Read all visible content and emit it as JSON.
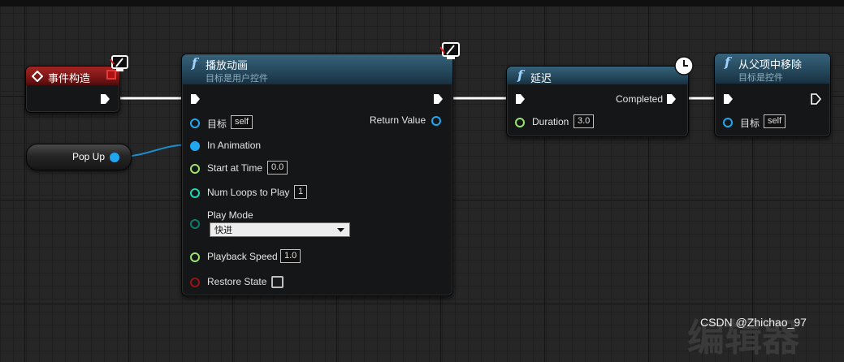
{
  "colors": {
    "exec": "#ffffff",
    "object_pin": "#1fa7f2",
    "float_pin": "#9be36a",
    "int_pin": "#1dd6b4",
    "enum_pin": "#0b7a6d",
    "bool_pin": "#9a1212",
    "wire_data": "#1a8fd0"
  },
  "event_node": {
    "title": "事件构造",
    "icon": "event-diamond-icon"
  },
  "play_node": {
    "title": "播放动画",
    "subtitle": "目标是用户控件",
    "target_label": "目标",
    "target_value": "self",
    "return_label": "Return Value",
    "in_animation_label": "In Animation",
    "start_time_label": "Start at Time",
    "start_time_value": "0.0",
    "num_loops_label": "Num Loops to Play",
    "num_loops_value": "1",
    "play_mode_label": "Play Mode",
    "play_mode_value": "快进",
    "playback_speed_label": "Playback Speed",
    "playback_speed_value": "1.0",
    "restore_state_label": "Restore State",
    "restore_state_checked": false
  },
  "delay_node": {
    "title": "延迟",
    "completed_label": "Completed",
    "duration_label": "Duration",
    "duration_value": "3.0"
  },
  "remove_node": {
    "title": "从父项中移除",
    "subtitle": "目标是控件",
    "target_label": "目标",
    "target_value": "self"
  },
  "var_node": {
    "label": "Pop Up"
  },
  "watermark": {
    "text": "CSDN @Zhichao_97"
  },
  "ghost_text": "编辑器"
}
